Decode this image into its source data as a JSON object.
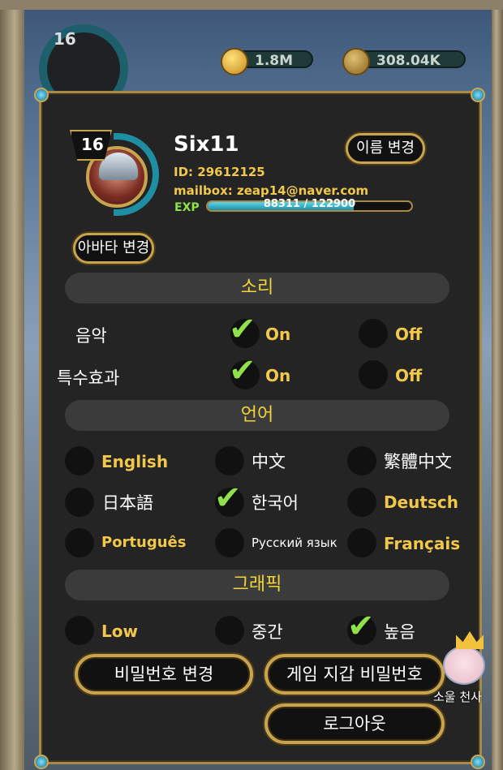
{
  "hud": {
    "level": "16",
    "gold": "1.8M",
    "power": "308.04K"
  },
  "profile": {
    "level": "16",
    "name": "Six11",
    "id_text": "ID: 29612125",
    "mailbox_text": "mailbox: zeap14@naver.com",
    "exp_label": "EXP",
    "exp_text": "88311 / 122900",
    "exp_fraction": 0.7185,
    "rename_button": "이름 변경",
    "avatar_button": "아바타 변경"
  },
  "sound": {
    "title": "소리",
    "music_label": "음악",
    "effects_label": "특수효과",
    "on": "On",
    "off": "Off"
  },
  "language": {
    "title": "언어",
    "options": [
      "English",
      "中文",
      "繁體中文",
      "日本語",
      "한국어",
      "Deutsch",
      "Português",
      "Русский язык",
      "Français"
    ],
    "selected": "한국어"
  },
  "graphics": {
    "title": "그래픽",
    "options": [
      "Low",
      "중간",
      "높음"
    ],
    "selected": "높음"
  },
  "buttons": {
    "change_password": "비밀번호 변경",
    "wallet_password": "게임 지갑 비밀번호",
    "logout": "로그아웃"
  },
  "helper": {
    "name": "소울 천사"
  },
  "colors": {
    "accent_gold": "#c9a44e",
    "section_text": "#f3d53a",
    "check_green": "#8fe04a",
    "exp_blue": "#1e8ea2"
  }
}
